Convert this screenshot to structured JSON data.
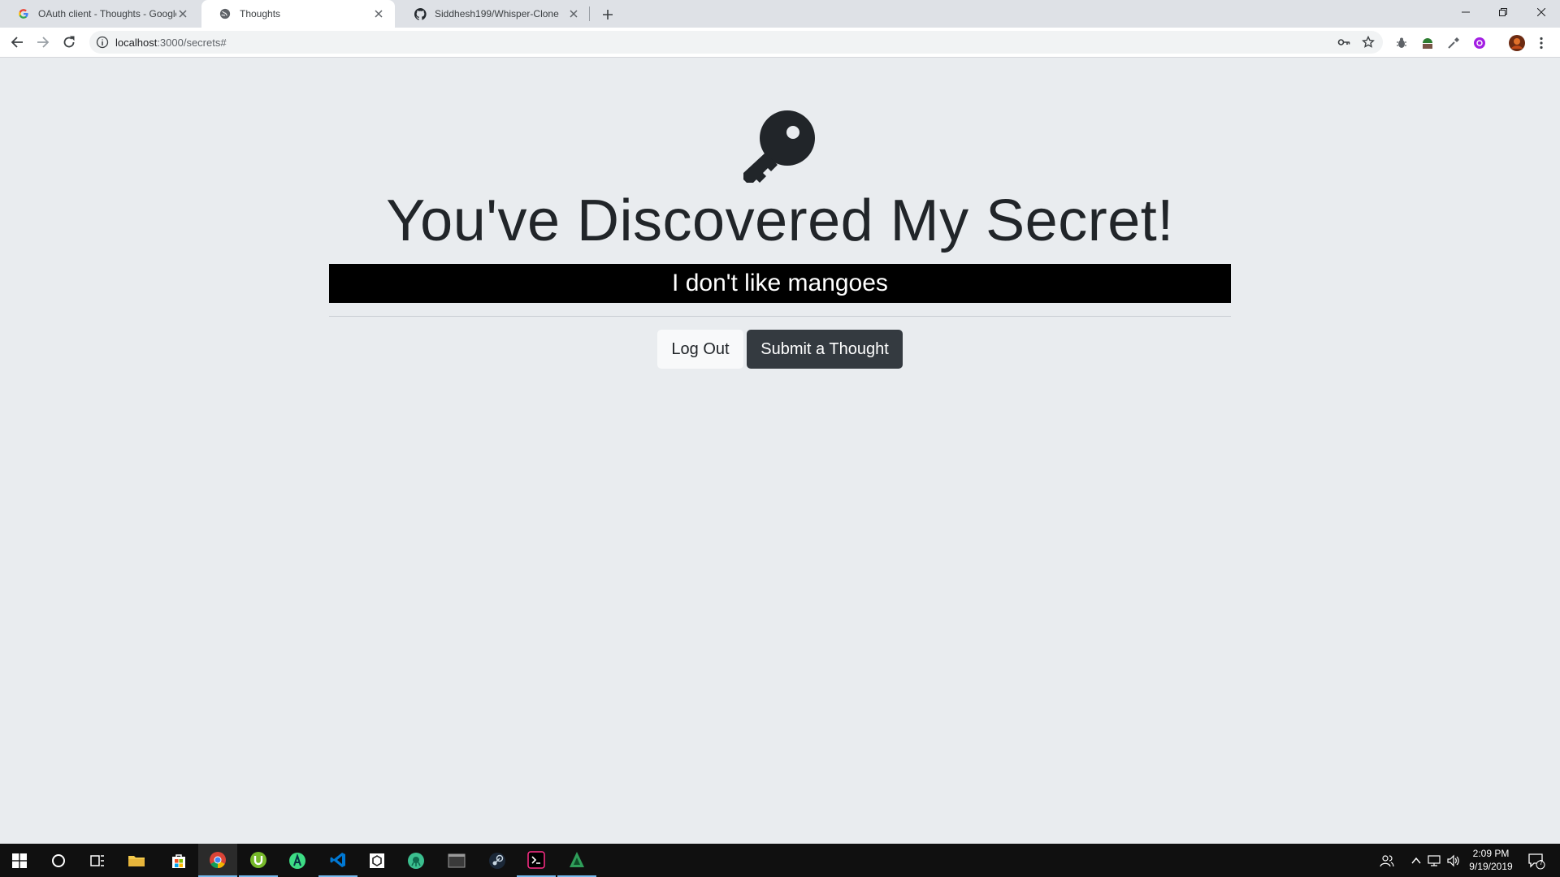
{
  "browser": {
    "tabs": [
      {
        "title": "OAuth client - Thoughts - Google",
        "favicon": "google-icon",
        "active": false
      },
      {
        "title": "Thoughts",
        "favicon": "globe-icon",
        "active": true
      },
      {
        "title": "Siddhesh199/Whisper-Clone",
        "favicon": "github-icon",
        "active": false
      }
    ],
    "url_host": "localhost",
    "url_path": ":3000/secrets#",
    "extensions": [
      "bug-icon",
      "android-icon",
      "eyedropper-icon",
      "purple-extension-icon"
    ]
  },
  "page": {
    "headline": "You've Discovered My Secret!",
    "secret": "I don't like mangoes",
    "logout_label": "Log Out",
    "submit_label": "Submit a Thought"
  },
  "taskbar": {
    "apps": [
      "windows-start-icon",
      "cortana-icon",
      "task-view-icon",
      "file-explorer-icon",
      "store-icon",
      "chrome-icon",
      "utorrent-icon",
      "android-studio-icon",
      "vscode-icon",
      "unity-icon",
      "gitkraken-icon",
      "terminal-window-icon",
      "steam-icon",
      "hyper-terminal-icon",
      "atom-icon"
    ],
    "time": "2:09 PM",
    "date": "9/19/2019",
    "notification_count": "7"
  },
  "colors": {
    "page_bg": "#e9ecef",
    "text_dark": "#212529",
    "btn_dark": "#343a40",
    "btn_light": "#f8f9fa",
    "secret_bg": "#000000"
  }
}
